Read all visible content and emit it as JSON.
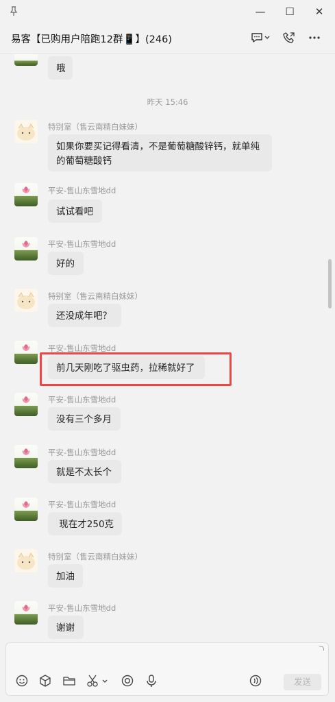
{
  "window": {
    "pin_icon": "pin-icon",
    "minimize": "—",
    "maximize": "☐",
    "close": "✕"
  },
  "header": {
    "title": "易客【已购用户陪跑12群📱】(246)",
    "chat_icon": "chat-bubble-icon",
    "call_icon": "phone-icon",
    "more_icon": "more-icon"
  },
  "messages": [
    {
      "type": "bubble",
      "text": "哦"
    },
    {
      "type": "time",
      "text": "昨天 15:46"
    },
    {
      "sender": "特别室（售云南精白妹妹）",
      "line1": "如果你要买记得看清，不是葡萄糖酸锌钙，就单纯",
      "line2": "的葡萄糖酸钙"
    },
    {
      "sender": "平安-售山东雪地dd",
      "text": "试试看吧"
    },
    {
      "sender": "平安-售山东雪地dd",
      "text": "好的"
    },
    {
      "sender": "特别室（售云南精白妹妹）",
      "text": "还没成年吧？"
    },
    {
      "sender": "平安-售山东雪地dd",
      "text": "前几天刚吃了驱虫药，拉稀就好了"
    },
    {
      "sender": "平安-售山东雪地dd",
      "text": "没有三个多月"
    },
    {
      "sender": "平安-售山东雪地dd",
      "text": "就是不太长个"
    },
    {
      "sender": "平安-售山东雪地dd",
      "text": " 现在才250克"
    },
    {
      "sender": "特别室（售云南精白妹妹）",
      "text": "加油"
    },
    {
      "sender": "平安-售山东雪地dd",
      "text": "谢谢"
    }
  ],
  "input": {
    "send_label": "发送"
  }
}
